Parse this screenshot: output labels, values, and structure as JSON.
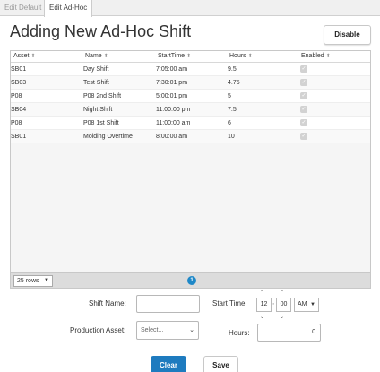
{
  "tabs": [
    {
      "label": "Edit Default",
      "active": false
    },
    {
      "label": "Edit Ad-Hoc",
      "active": true
    }
  ],
  "header": {
    "title": "Adding New Ad-Hoc Shift",
    "disable_label": "Disable"
  },
  "table": {
    "columns": [
      "Asset",
      "Name",
      "StartTime",
      "Hours",
      "Enabled"
    ],
    "rows": [
      {
        "asset": "SB01",
        "name": "Day Shift",
        "start": "7:05:00 am",
        "hours": "9.5",
        "enabled": true
      },
      {
        "asset": "SB03",
        "name": "Test Shift",
        "start": "7:30:01 pm",
        "hours": "4.75",
        "enabled": true
      },
      {
        "asset": "P08",
        "name": "P08 2nd Shift",
        "start": "5:00:01 pm",
        "hours": "5",
        "enabled": true
      },
      {
        "asset": "SB04",
        "name": "Night Shift",
        "start": "11:00:00 pm",
        "hours": "7.5",
        "enabled": true
      },
      {
        "asset": "P08",
        "name": "P08 1st Shift",
        "start": "11:00:00 am",
        "hours": "6",
        "enabled": true
      },
      {
        "asset": "SB01",
        "name": "Molding Overtime",
        "start": "8:00:00 am",
        "hours": "10",
        "enabled": true
      }
    ],
    "rows_per_page": "25 rows",
    "current_page": "1"
  },
  "form": {
    "shift_name_label": "Shift Name:",
    "shift_name_value": "",
    "production_asset_label": "Production Asset:",
    "production_asset_placeholder": "Select...",
    "start_time_label": "Start Time:",
    "start_hour": "12",
    "start_minute": "00",
    "start_ampm": "AM",
    "hours_label": "Hours:",
    "hours_value": "0",
    "clear_label": "Clear",
    "save_label": "Save"
  },
  "colors": {
    "accent": "#1e7bbf",
    "page_badge": "#1e88c8"
  }
}
